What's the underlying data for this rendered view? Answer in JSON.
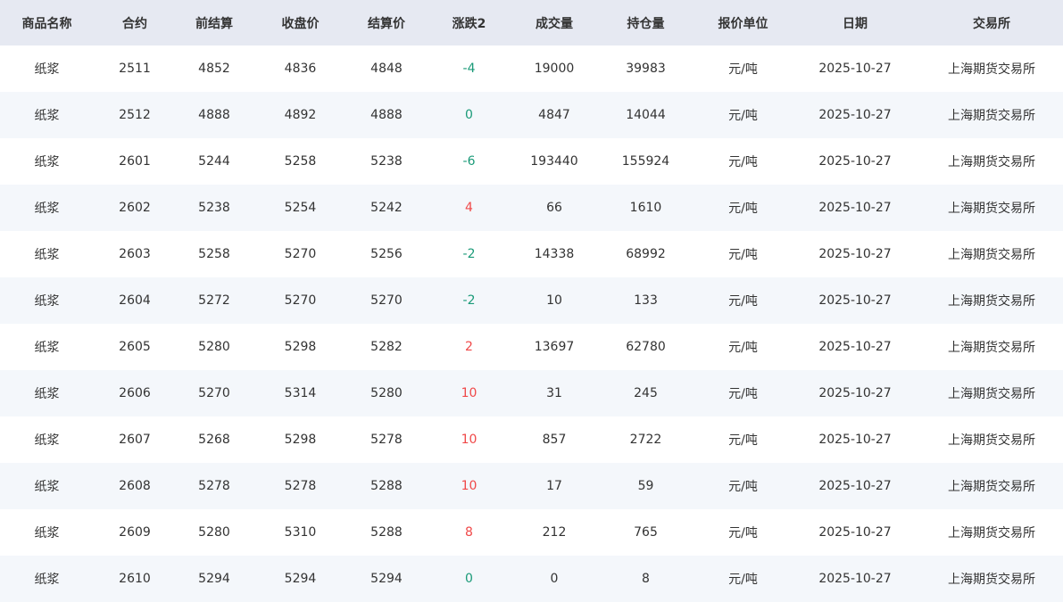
{
  "table": {
    "headers": [
      "商品名称",
      "合约",
      "前结算",
      "收盘价",
      "结算价",
      "涨跌2",
      "成交量",
      "持仓量",
      "报价单位",
      "日期",
      "交易所"
    ],
    "rows": [
      [
        "纸浆",
        "2511",
        "4852",
        "4836",
        "4848",
        "-4",
        "19000",
        "39983",
        "元/吨",
        "2025-10-27",
        "上海期货交易所"
      ],
      [
        "纸浆",
        "2512",
        "4888",
        "4892",
        "4888",
        "0",
        "4847",
        "14044",
        "元/吨",
        "2025-10-27",
        "上海期货交易所"
      ],
      [
        "纸浆",
        "2601",
        "5244",
        "5258",
        "5238",
        "-6",
        "193440",
        "155924",
        "元/吨",
        "2025-10-27",
        "上海期货交易所"
      ],
      [
        "纸浆",
        "2602",
        "5238",
        "5254",
        "5242",
        "4",
        "66",
        "1610",
        "元/吨",
        "2025-10-27",
        "上海期货交易所"
      ],
      [
        "纸浆",
        "2603",
        "5258",
        "5270",
        "5256",
        "-2",
        "14338",
        "68992",
        "元/吨",
        "2025-10-27",
        "上海期货交易所"
      ],
      [
        "纸浆",
        "2604",
        "5272",
        "5270",
        "5270",
        "-2",
        "10",
        "133",
        "元/吨",
        "2025-10-27",
        "上海期货交易所"
      ],
      [
        "纸浆",
        "2605",
        "5280",
        "5298",
        "5282",
        "2",
        "13697",
        "62780",
        "元/吨",
        "2025-10-27",
        "上海期货交易所"
      ],
      [
        "纸浆",
        "2606",
        "5270",
        "5314",
        "5280",
        "10",
        "31",
        "245",
        "元/吨",
        "2025-10-27",
        "上海期货交易所"
      ],
      [
        "纸浆",
        "2607",
        "5268",
        "5298",
        "5278",
        "10",
        "857",
        "2722",
        "元/吨",
        "2025-10-27",
        "上海期货交易所"
      ],
      [
        "纸浆",
        "2608",
        "5278",
        "5278",
        "5288",
        "10",
        "17",
        "59",
        "元/吨",
        "2025-10-27",
        "上海期货交易所"
      ],
      [
        "纸浆",
        "2609",
        "5280",
        "5310",
        "5288",
        "8",
        "212",
        "765",
        "元/吨",
        "2025-10-27",
        "上海期货交易所"
      ],
      [
        "纸浆",
        "2610",
        "5294",
        "5294",
        "5294",
        "0",
        "0",
        "8",
        "元/吨",
        "2025-10-27",
        "上海期货交易所"
      ]
    ]
  },
  "colors": {
    "up": "#f04848",
    "down": "#1a9a78",
    "flat": "#1a9a78",
    "header_bg": "#e6e9f2",
    "alt_row_bg": "#f4f7fb"
  }
}
